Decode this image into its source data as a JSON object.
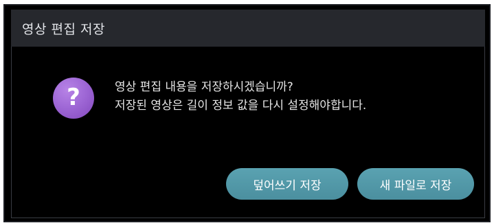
{
  "dialog": {
    "title": "영상 편집 저장",
    "icon": "question-icon",
    "icon_glyph": "?",
    "icon_color": "#9f68d6",
    "message_line1": "영상 편집 내용을 저장하시겠습니까?",
    "message_line2": "저장된 영상은 길이 정보 값을 다시 설정해야합니다.",
    "buttons": {
      "overwrite_label": "덮어쓰기 저장",
      "save_new_label": "새 파일로 저장"
    },
    "button_color": "#52999f"
  }
}
